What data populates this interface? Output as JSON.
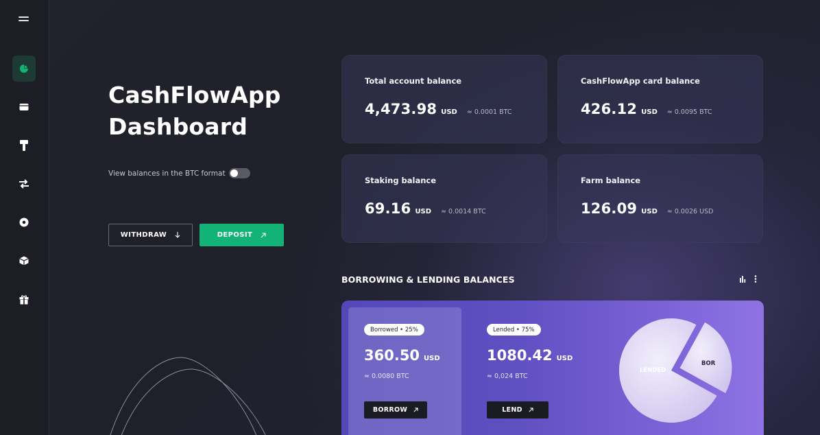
{
  "sidebar": {
    "items": [
      {
        "icon": "pie-chart-icon",
        "active": true
      },
      {
        "icon": "wallet-icon",
        "active": false
      },
      {
        "icon": "paint-roller-icon",
        "active": false
      },
      {
        "icon": "exchange-arrows-icon",
        "active": false
      },
      {
        "icon": "disc-icon",
        "active": false
      },
      {
        "icon": "box-icon",
        "active": false
      },
      {
        "icon": "gift-icon",
        "active": false
      }
    ]
  },
  "header": {
    "title_line1": "CashFlowApp",
    "title_line2": "Dashboard"
  },
  "btc_toggle": {
    "label": "View balances in the BTC format",
    "on": false
  },
  "actions": {
    "withdraw_label": "WITHDRAW",
    "deposit_label": "DEPOSIT"
  },
  "cards": [
    {
      "title": "Total account balance",
      "amount": "4,473.98",
      "currency": "USD",
      "conversion": "≈ 0.0001 BTC"
    },
    {
      "title": "CashFlowApp card balance",
      "amount": "426.12",
      "currency": "USD",
      "conversion": "≈ 0.0095 BTC"
    },
    {
      "title": "Staking balance",
      "amount": "69.16",
      "currency": "USD",
      "conversion": "≈ 0.0014 BTC"
    },
    {
      "title": "Farm balance",
      "amount": "126.09",
      "currency": "USD",
      "conversion": "≈ 0.0026 USD"
    }
  ],
  "lending": {
    "section_title": "BORROWING & LENDING BALANCES",
    "borrowed": {
      "pill": "Borrowed • 25%",
      "amount": "360.50",
      "currency": "USD",
      "conversion": "≈ 0.0080 BTC",
      "button": "BORROW"
    },
    "lended": {
      "pill": "Lended • 75%",
      "amount": "1080.42",
      "currency": "USD",
      "conversion": "≈ 0,024 BTC",
      "button": "LEND"
    },
    "pie": {
      "lended_label": "LENDED",
      "borrowed_label": "BOR",
      "borrowed_share": 25,
      "lended_share": 75
    }
  },
  "colors": {
    "accent_green": "#13b378",
    "active_sidebar_bg": "#1e3a35",
    "panel_purple": "#5f4fc0"
  }
}
